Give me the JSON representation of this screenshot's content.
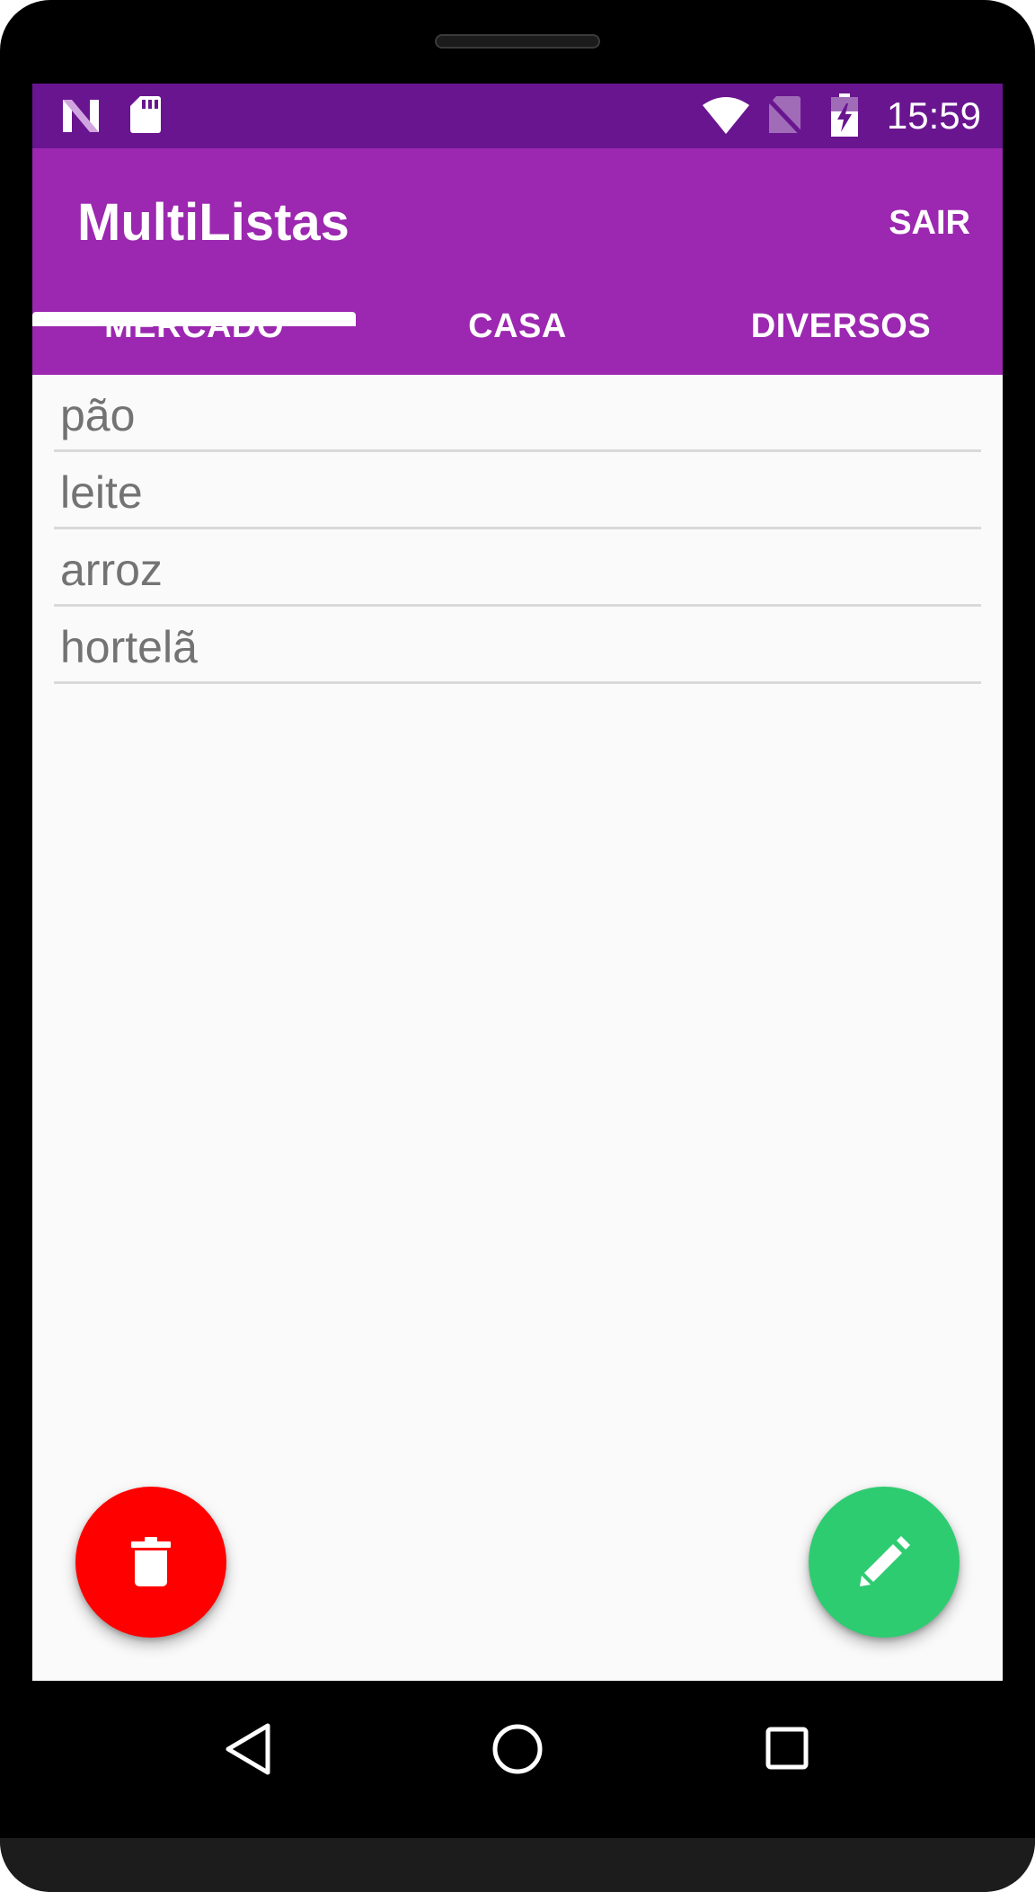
{
  "status_bar": {
    "time": "15:59",
    "icons": [
      "n-notification-icon",
      "sd-card-icon",
      "wifi-icon",
      "no-sim-icon",
      "battery-charging-icon"
    ]
  },
  "app_bar": {
    "title": "MultiListas",
    "action_label": "SAIR"
  },
  "tabs": [
    {
      "label": "MERCADO",
      "selected": true
    },
    {
      "label": "CASA",
      "selected": false
    },
    {
      "label": "DIVERSOS",
      "selected": false
    }
  ],
  "list": {
    "items": [
      "pão",
      "leite",
      "arroz",
      "hortelã"
    ]
  },
  "fabs": {
    "delete_icon": "trash-icon",
    "delete_color": "#ff0000",
    "edit_icon": "pencil-icon",
    "edit_color": "#2ecc71"
  },
  "nav_bar": {
    "icons": [
      "back-icon",
      "home-icon",
      "recents-icon"
    ]
  },
  "colors": {
    "primary": "#9c27b0",
    "primary_dark": "#6a1590"
  }
}
